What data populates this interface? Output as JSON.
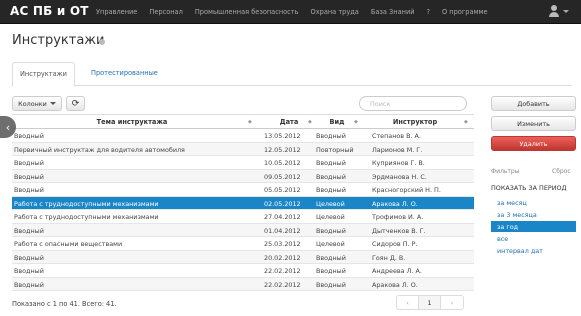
{
  "navbar": {
    "brand": "АС ПБ и ОТ",
    "items": [
      "Управление",
      "Персонал",
      "Промышленная безопасность",
      "Охрана труда",
      "База Знаний",
      "?",
      "О программе"
    ]
  },
  "page": {
    "title": "Инструктажи"
  },
  "tabs": {
    "active": "Инструктажи",
    "other": "Протестированные"
  },
  "toolbar": {
    "columns_label": "Колонки",
    "refresh_icon": "⟳",
    "search_placeholder": "Поиск"
  },
  "table": {
    "headers": {
      "theme": "Тема инструктажа",
      "date": "Дата",
      "kind": "Вид",
      "instructor": "Инструктор"
    },
    "rows": [
      {
        "theme": "Вводный",
        "date": "13.05.2012",
        "kind": "Вводный",
        "instructor": "Степанов В. А."
      },
      {
        "theme": "Первичный инструктаж для водителя автомобиля",
        "date": "12.05.2012",
        "kind": "Повторный",
        "instructor": "Ларионов М. Г."
      },
      {
        "theme": "Вводный",
        "date": "10.05.2012",
        "kind": "Вводный",
        "instructor": "Куприянов Г. В."
      },
      {
        "theme": "Вводный",
        "date": "09.05.2012",
        "kind": "Вводный",
        "instructor": "Эрдманова Н. С."
      },
      {
        "theme": "Вводный",
        "date": "05.05.2012",
        "kind": "Вводный",
        "instructor": "Красногорский Н. П."
      },
      {
        "theme": "Работа с труднодоступными механизмами",
        "date": "02.05.2012",
        "kind": "Целевой",
        "instructor": "Аракова Л. О."
      },
      {
        "theme": "Работа с труднодоступными механизмами",
        "date": "27.04.2012",
        "kind": "Целевой",
        "instructor": "Трофимов И. А."
      },
      {
        "theme": "Вводный",
        "date": "01.04.2012",
        "kind": "Вводный",
        "instructor": "Дытченков В. Г."
      },
      {
        "theme": "Работа с опасными веществами",
        "date": "25.03.2012",
        "kind": "Целевой",
        "instructor": "Сидоров П. Р."
      },
      {
        "theme": "Вводный",
        "date": "20.02.2012",
        "kind": "Вводный",
        "instructor": "Гоян Д. В."
      },
      {
        "theme": "Вводный",
        "date": "22.02.2012",
        "kind": "Вводный",
        "instructor": "Андреева Л. А."
      },
      {
        "theme": "Вводный",
        "date": "22.02.2012",
        "kind": "Вводный",
        "instructor": "Аракова Л. О."
      }
    ],
    "selected_index": 5
  },
  "pagination": {
    "info": "Показано с 1 по 41. Всего: 41.",
    "prev": "‹",
    "current": "1",
    "next": "›"
  },
  "actions": {
    "add": "Добавить",
    "edit": "Изменить",
    "delete": "Удалить"
  },
  "filters": {
    "label": "Фильтры",
    "reset": "Сброс",
    "period_title": "ПОКАЗАТЬ ЗА ПЕРИОД",
    "periods": [
      "за месяц",
      "за 3 месяца",
      "за год",
      "все",
      "интервал дат"
    ],
    "active_period_index": 2
  },
  "colors": {
    "navbar": "#262626",
    "accent": "#1a86c8",
    "danger": "#d9534f",
    "link": "#1f6fb2"
  }
}
